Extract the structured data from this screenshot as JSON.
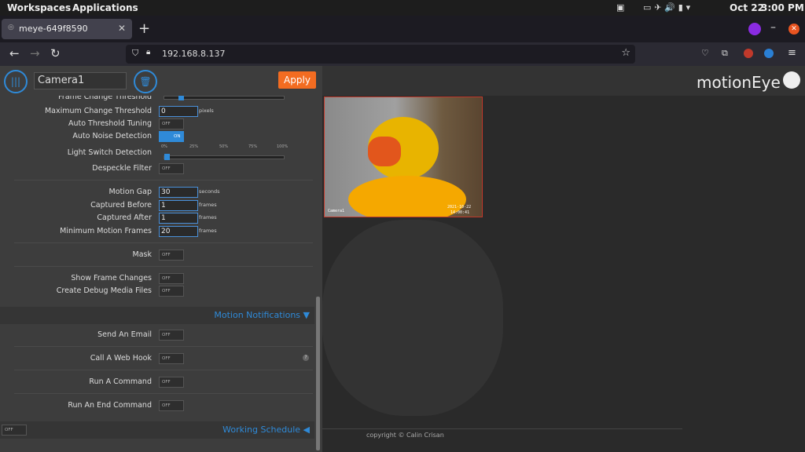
{
  "os": {
    "workspaces": "Workspaces",
    "applications": "Applications",
    "date": "Oct 22",
    "time": "3:00 PM"
  },
  "browser": {
    "tab_title": "meye-649f8590",
    "url": "192.168.8.137"
  },
  "app": {
    "camera_name": "Camera1",
    "apply_label": "Apply",
    "logo": "motionEye",
    "copyright": "copyright © Calin Crisan",
    "camera_overlay_left": "Camera1",
    "camera_overlay_date": "2021-10-22",
    "camera_overlay_time": "14:00:41"
  },
  "settings": {
    "frame_change_threshold": "Frame Change Threshold",
    "max_change_threshold": {
      "label": "Maximum Change Threshold",
      "value": "0",
      "unit": "pixels"
    },
    "auto_threshold_tuning": {
      "label": "Auto Threshold Tuning",
      "state": "OFF"
    },
    "auto_noise_detection": {
      "label": "Auto Noise Detection",
      "state": "ON"
    },
    "light_switch_detection": {
      "label": "Light Switch Detection",
      "ticks": [
        "0%",
        "25%",
        "50%",
        "75%",
        "100%"
      ]
    },
    "despeckle_filter": {
      "label": "Despeckle Filter",
      "state": "OFF"
    },
    "motion_gap": {
      "label": "Motion Gap",
      "value": "30",
      "unit": "seconds"
    },
    "captured_before": {
      "label": "Captured Before",
      "value": "1",
      "unit": "frames"
    },
    "captured_after": {
      "label": "Captured After",
      "value": "1",
      "unit": "frames"
    },
    "minimum_motion_frames": {
      "label": "Minimum Motion Frames",
      "value": "20",
      "unit": "frames"
    },
    "mask": {
      "label": "Mask",
      "state": "OFF"
    },
    "show_frame_changes": {
      "label": "Show Frame Changes",
      "state": "OFF"
    },
    "create_debug_media_files": {
      "label": "Create Debug Media Files",
      "state": "OFF"
    }
  },
  "motion_notifications": {
    "title": "Motion Notifications",
    "send_email": {
      "label": "Send An Email",
      "state": "OFF"
    },
    "call_web_hook": {
      "label": "Call A Web Hook",
      "state": "OFF"
    },
    "run_command": {
      "label": "Run A Command",
      "state": "OFF"
    },
    "run_end_command": {
      "label": "Run An End Command",
      "state": "OFF"
    }
  },
  "working_schedule": {
    "title": "Working Schedule",
    "state": "OFF"
  },
  "colors": {
    "accent": "#2f8ad8",
    "apply": "#f36c21"
  }
}
